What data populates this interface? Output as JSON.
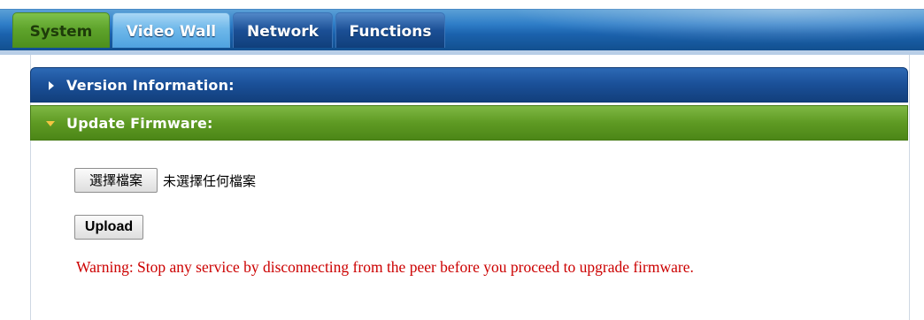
{
  "tabs": [
    {
      "label": "System",
      "state": "active"
    },
    {
      "label": "Video Wall",
      "state": "hover"
    },
    {
      "label": "Network",
      "state": "normal"
    },
    {
      "label": "Functions",
      "state": "normal"
    }
  ],
  "sections": {
    "version": {
      "title": "Version Information:",
      "expanded": false
    },
    "firmware": {
      "title": "Update Firmware:",
      "expanded": true
    }
  },
  "firmware_form": {
    "choose_file_label": "選擇檔案",
    "no_file_text": "未選擇任何檔案",
    "upload_label": "Upload",
    "warning": "Warning: Stop any service by disconnecting from the peer before you proceed to upgrade firmware."
  },
  "colors": {
    "active_tab": "#5fa42c",
    "section_blue": "#1a4f97",
    "section_green": "#5e9a23",
    "warning_text": "#cc0000"
  }
}
